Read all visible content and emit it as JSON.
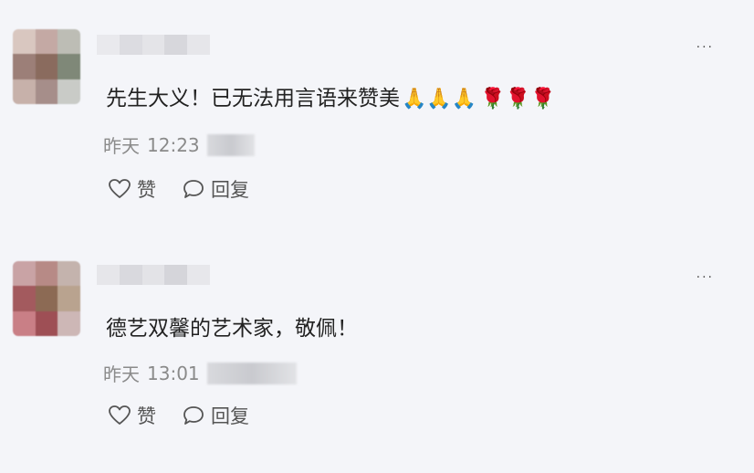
{
  "comments": [
    {
      "text": "先生大义！已无法用言语来赞美",
      "emoji_hands": "🙏🙏🙏",
      "emoji_roses": "🌹🌹🌹",
      "date_label": "昨天",
      "time": "12:23",
      "like_label": "赞",
      "reply_label": "回复",
      "more_label": "···"
    },
    {
      "text": "德艺双馨的艺术家，敬佩！",
      "date_label": "昨天",
      "time": "13:01",
      "like_label": "赞",
      "reply_label": "回复",
      "more_label": "···"
    }
  ],
  "colors": {
    "background": "#f4f5f9",
    "meta_text": "#8a8a8a",
    "action_text": "#555555"
  },
  "icons": [
    "heart-icon",
    "comment-bubble-icon",
    "more-icon"
  ]
}
